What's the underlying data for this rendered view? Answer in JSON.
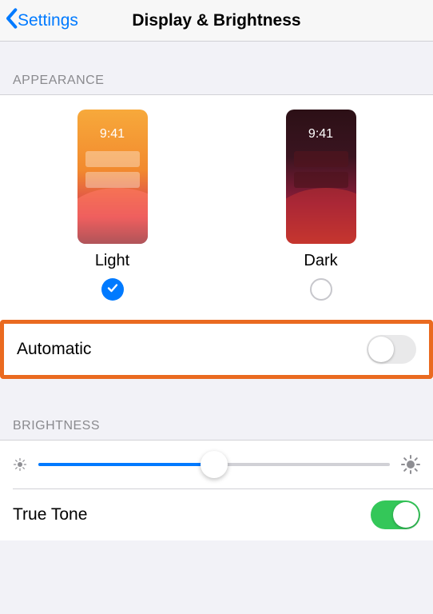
{
  "nav": {
    "back_label": "Settings",
    "title": "Display & Brightness"
  },
  "appearance": {
    "header": "APPEARANCE",
    "preview_time": "9:41",
    "light_label": "Light",
    "dark_label": "Dark",
    "selected": "light",
    "automatic_label": "Automatic",
    "automatic_on": false
  },
  "brightness": {
    "header": "BRIGHTNESS",
    "value_percent": 50,
    "true_tone_label": "True Tone",
    "true_tone_on": true
  }
}
